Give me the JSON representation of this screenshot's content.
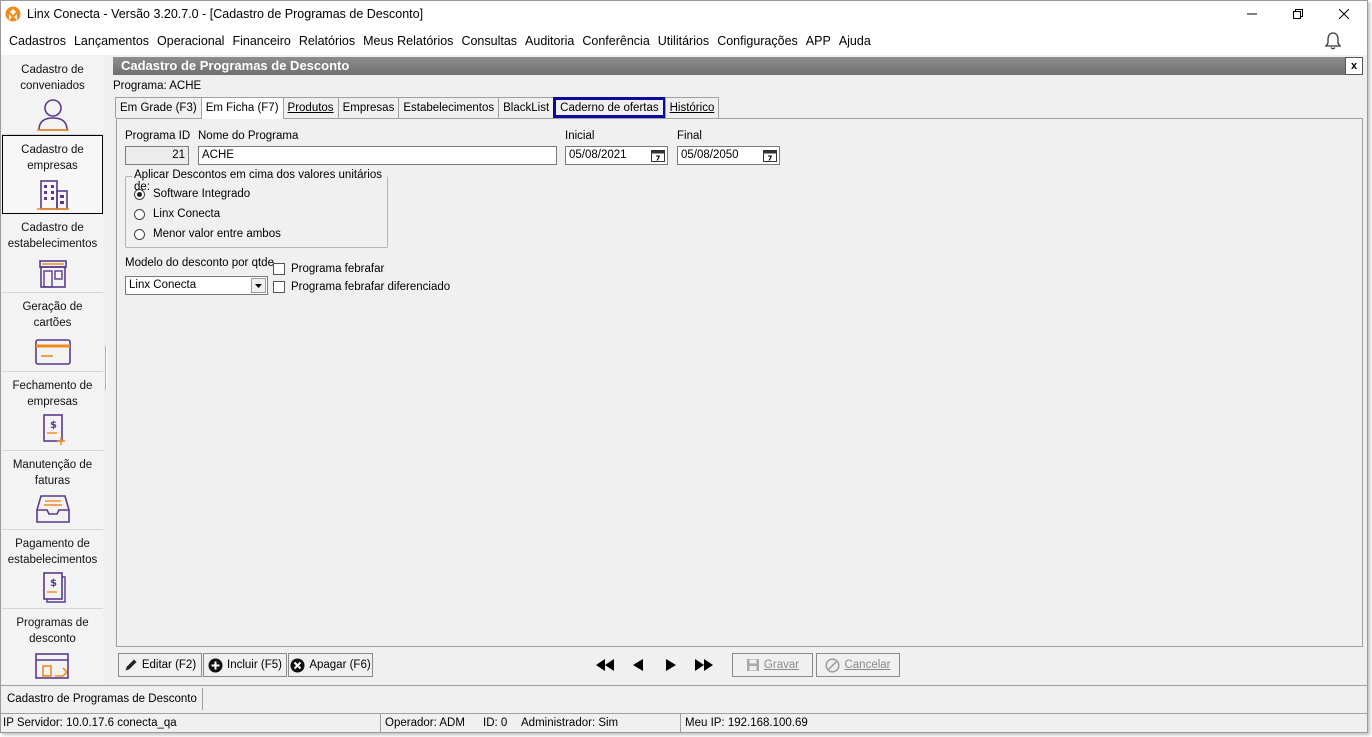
{
  "window": {
    "title": "Linx Conecta - Versão 3.20.7.0 - [Cadastro de Programas de Desconto]"
  },
  "menu": [
    {
      "label": "Cadastros"
    },
    {
      "label": "Lançamentos"
    },
    {
      "label": "Operacional"
    },
    {
      "label": "Financeiro"
    },
    {
      "label": "Relatórios"
    },
    {
      "label": "Meus Relatórios"
    },
    {
      "label": "Consultas"
    },
    {
      "label": "Auditoria"
    },
    {
      "label": "Conferência"
    },
    {
      "label": "Utilitários"
    },
    {
      "label": "Configurações"
    },
    {
      "label": "APP"
    },
    {
      "label": "Ajuda"
    }
  ],
  "sidebar": {
    "items": [
      {
        "label": "Cadastro de conveniados",
        "icon": "user-icon"
      },
      {
        "label": "Cadastro de empresas",
        "icon": "building-icon"
      },
      {
        "label": "Cadastro de estabelecimentos",
        "icon": "store-icon"
      },
      {
        "label": "Geração de cartões",
        "icon": "card-icon"
      },
      {
        "label": "Fechamento de empresas",
        "icon": "invoice-add-icon"
      },
      {
        "label": "Manutenção de faturas",
        "icon": "inbox-tray-icon"
      },
      {
        "label": "Pagamento de estabelecimentos",
        "icon": "invoice-icon"
      },
      {
        "label": "Programas de desconto",
        "icon": "discount-program-icon"
      }
    ]
  },
  "form": {
    "title": "Cadastro de Programas de Desconto",
    "close_label": "x",
    "program_label": "Programa: ACHE"
  },
  "tabs": [
    {
      "label": "Em Grade (F3)"
    },
    {
      "label": "Em Ficha (F7)"
    },
    {
      "label": "Produtos"
    },
    {
      "label": "Empresas"
    },
    {
      "label": "Estabelecimentos"
    },
    {
      "label": "BlackList"
    },
    {
      "label": "Caderno de ofertas"
    },
    {
      "label": "Histórico"
    }
  ],
  "fields": {
    "program_id_label": "Programa ID",
    "program_id_value": "21",
    "program_name_label": "Nome do Programa",
    "program_name_value": "ACHE",
    "start_label": "Inicial",
    "start_value": "05/08/2021",
    "end_label": "Final",
    "end_value": "05/08/2050"
  },
  "discount_group": {
    "title": "Aplicar Descontos em cima dos valores unitários de:",
    "options": [
      {
        "label": "Software Integrado",
        "checked": true
      },
      {
        "label": "Linx Conecta",
        "checked": false
      },
      {
        "label": "Menor valor entre ambos",
        "checked": false
      }
    ]
  },
  "quantity_model": {
    "label": "Modelo do desconto por qtde",
    "selected": "Linx Conecta"
  },
  "checkboxes": [
    {
      "label": "Programa febrafar",
      "checked": false
    },
    {
      "label": "Programa febrafar diferenciado",
      "checked": false
    }
  ],
  "toolbar": {
    "edit_label": "Editar (F2)",
    "add_label": "Incluir (F5)",
    "delete_label": "Apagar (F6)",
    "save_label": "Gravar",
    "cancel_label": "Cancelar"
  },
  "taskbar": {
    "open_form": "Cadastro de Programas de Desconto"
  },
  "status": {
    "server": "IP Servidor: 10.0.17.6 conecta_qa",
    "operator": "Operador: ADM",
    "id": "ID: 0",
    "admin": "Administrador: Sim",
    "my_ip": "Meu IP: 192.168.100.69"
  },
  "colors": {
    "accent_orange": "#f08c1e",
    "tab_highlight": "#0a0a9c",
    "header_gray": "#7a7a7a"
  }
}
